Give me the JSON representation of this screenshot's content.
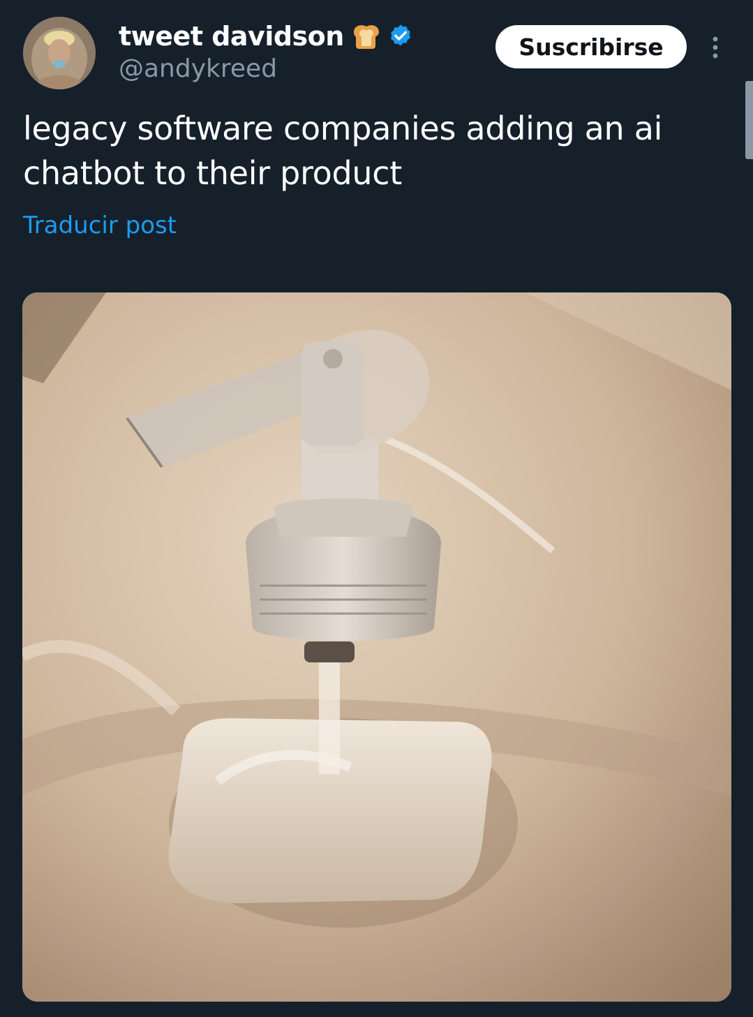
{
  "tweet": {
    "author": {
      "display_name": "tweet davidson",
      "handle": "@andykreed",
      "badge_emoji": "bread-icon",
      "verified": true
    },
    "subscribe_label": "Suscribirse",
    "text": "legacy software companies adding an ai chatbot to their product",
    "translate_label": "Traducir post",
    "media": {
      "description_icon": "photo"
    }
  },
  "colors": {
    "background": "#15202b",
    "accent": "#1d9bf0",
    "secondary_text": "#8b98a5"
  }
}
